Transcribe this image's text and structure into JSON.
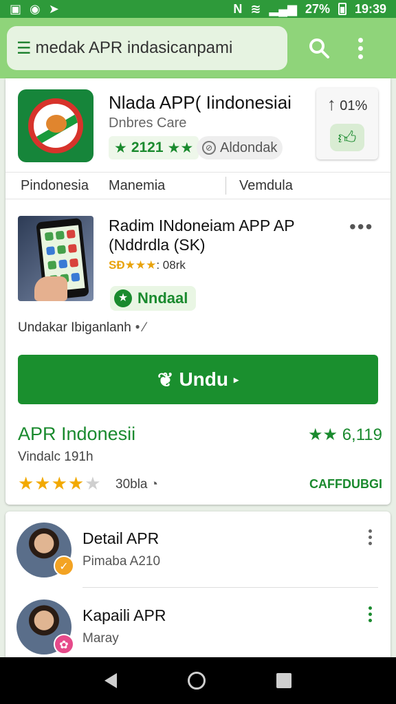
{
  "status_bar": {
    "left_icons": [
      "image-icon",
      "messenger-icon",
      "send-icon"
    ],
    "battery": "27%",
    "time": "19:39"
  },
  "app_bar": {
    "search_value": "medak APR indasicanpami"
  },
  "top_app": {
    "title": "Nlada APP( Iindonesiai",
    "developer": "Dnbres Care",
    "rating": "2121",
    "chip": "Aldondak",
    "side_tile": "01%"
  },
  "tabs": [
    "Pindonesia",
    "Manemia",
    "Vemdula"
  ],
  "second_app": {
    "title": "Radim INdoneiam APP AP (Nddrdla (SK)",
    "rating_stars": "SÐ★★★",
    "rating_rest": ": 08rk",
    "install_label": "Nndaal",
    "sub_link": "Undakar Ibiganlanh",
    "button_label": "Undu"
  },
  "app_footer": {
    "title": "APR Indonesii",
    "rating": "6,119",
    "subtitle": "Vindalc 191h",
    "stars_value": 4,
    "count": "30bla",
    "category": "CAFFDUBGI"
  },
  "list_items": [
    {
      "title": "Detail APR",
      "subtitle": "Pimaba A210"
    },
    {
      "title": "Kapaili APR",
      "subtitle": "Maray"
    }
  ],
  "colors": {
    "status_bar": "#2e9a3a",
    "app_bar": "#8fd47a",
    "primary_green": "#1a8f2e",
    "star": "#f2a900"
  }
}
